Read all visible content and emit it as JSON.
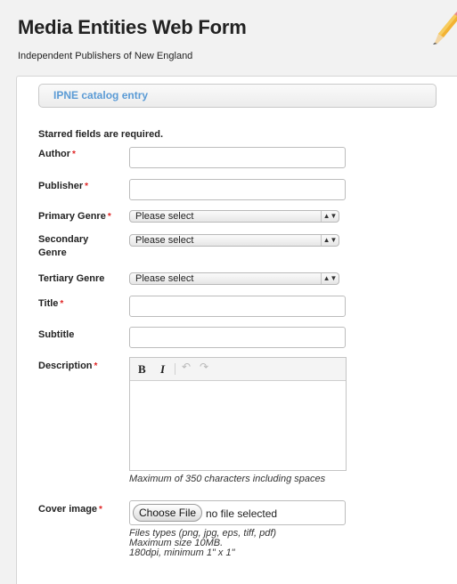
{
  "header": {
    "title": "Media Entities Web Form",
    "subtitle": "Independent Publishers of New England"
  },
  "section": {
    "title": "IPNE catalog entry"
  },
  "form": {
    "required_note": "Starred fields are required.",
    "required_marker": "*",
    "author_label": "Author",
    "publisher_label": "Publisher",
    "primary_genre_label": "Primary Genre",
    "secondary_genre_label_line1": "Secondary",
    "secondary_genre_label_line2": "Genre",
    "tertiary_genre_label": "Tertiary Genre",
    "title_label": "Title",
    "subtitle_label": "Subtitle",
    "description_label": "Description",
    "cover_image_label": "Cover image",
    "author_value": "",
    "publisher_value": "",
    "title_value": "",
    "subtitle_value": "",
    "select_default": "Please select",
    "select_arrows": "▲▼",
    "description_hint": "Maximum of 350 characters including spaces",
    "file_button": "Choose File",
    "file_status": "no file selected",
    "file_hint_1": "Files types (png, jpg, eps, tiff, pdf)",
    "file_hint_2": "Maximum size 10MB.",
    "file_hint_3": "180dpi, minimum 1\" x 1\""
  },
  "editor": {
    "bold": "B",
    "italic": "I",
    "undo": "↶",
    "redo": "↷"
  },
  "colors": {
    "accent": "#5b9bd5",
    "required": "#e02424"
  },
  "icons": [
    "pencil-icon",
    "bold-icon",
    "italic-icon",
    "undo-icon",
    "redo-icon",
    "select-arrow-icon"
  ]
}
